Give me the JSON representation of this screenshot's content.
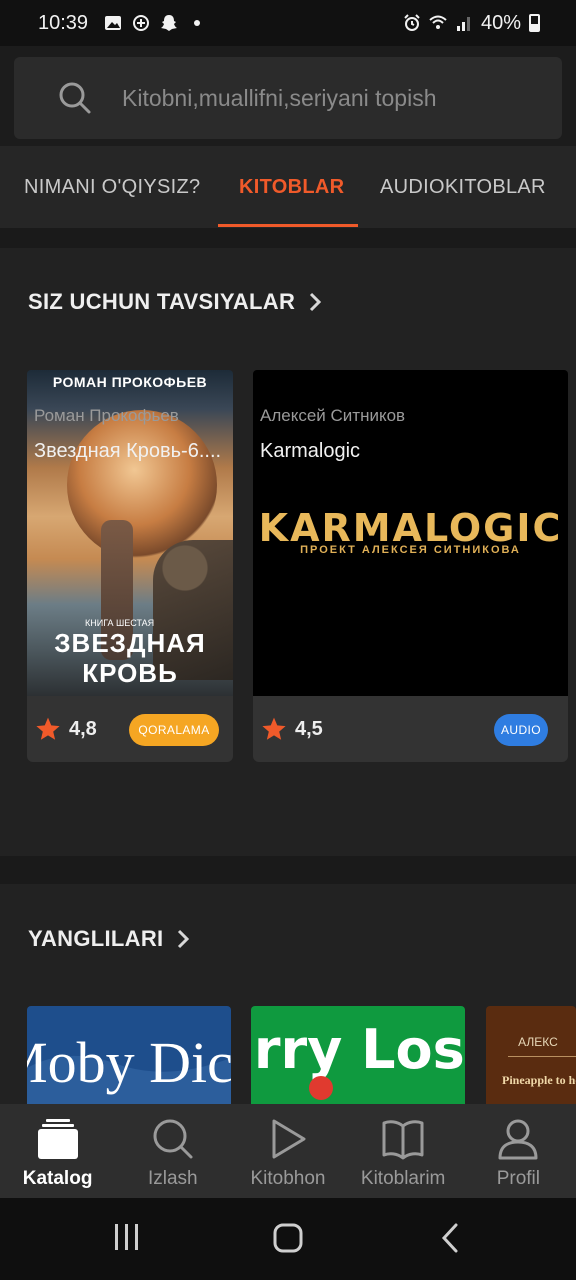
{
  "status": {
    "time": "10:39",
    "battery": "40%"
  },
  "search": {
    "placeholder": "Kitobni,muallifni,seriyani topish"
  },
  "tabs": [
    {
      "label": "NIMANI O'QIYSIZ?"
    },
    {
      "label": "KITOBLAR"
    },
    {
      "label": "AUDIOKITOBLAR"
    }
  ],
  "active_tab": "KITOBLAR",
  "recommend": {
    "title": "SIZ UCHUN TAVSIYALAR",
    "books": [
      {
        "rating": "4,8",
        "badge": "QORALAMA",
        "author": "Роман Прокофьев",
        "title": "Звездная Кровь-6....",
        "cover": {
          "author": "РОМАН ПРОКОФЬЕВ",
          "subtitle": "КНИГА ШЕСТАЯ",
          "title_line1": "ЗВЕЗДНАЯ",
          "title_line2": "КРОВЬ"
        }
      },
      {
        "rating": "4,5",
        "badge": "AUDIO",
        "author": "Алексей Ситников",
        "title": "Karmalogic",
        "cover": {
          "logo": "KARMALOGIC",
          "subtitle": "ПРОЕКТ АЛЕКСЕЯ СИТНИКОВА"
        }
      }
    ]
  },
  "new": {
    "title": "YANGLILARI",
    "covers": [
      {
        "text": "Moby Dick"
      },
      {
        "text": "Barry Losen"
      },
      {
        "top": "АЛЕКС",
        "text": "Pineapple to health"
      }
    ]
  },
  "bottom_nav": [
    {
      "label": "Katalog",
      "icon": "catalog-icon",
      "active": true
    },
    {
      "label": "Izlash",
      "icon": "search-icon",
      "active": false
    },
    {
      "label": "Kitobhon",
      "icon": "play-icon",
      "active": false
    },
    {
      "label": "Kitoblarim",
      "icon": "open-book-icon",
      "active": false
    },
    {
      "label": "Profil",
      "icon": "user-icon",
      "active": false
    }
  ],
  "colors": {
    "accent": "#f05a2a",
    "badge_orange": "#f5a623",
    "badge_blue": "#2f7de1",
    "star": "#f05a2a"
  }
}
